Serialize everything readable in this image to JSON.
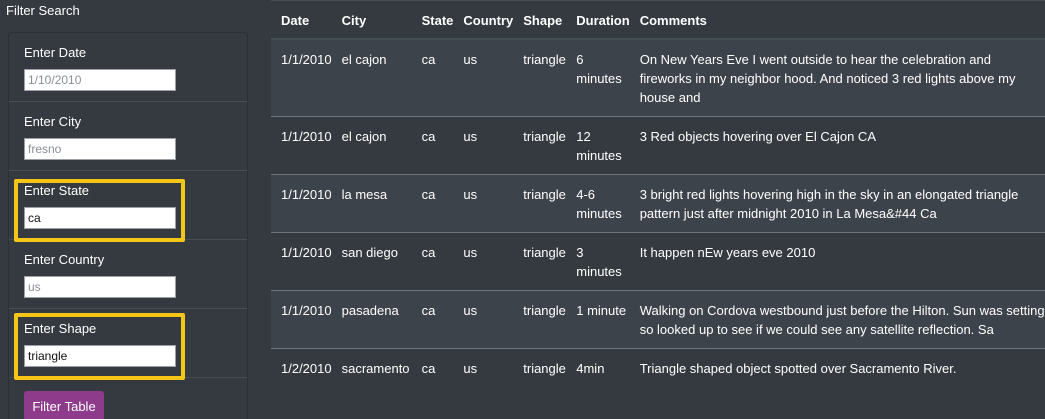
{
  "filter": {
    "title": "Filter Search",
    "fields": [
      {
        "label": "Enter Date",
        "value": "",
        "placeholder": "1/10/2010"
      },
      {
        "label": "Enter City",
        "value": "",
        "placeholder": "fresno"
      },
      {
        "label": "Enter State",
        "value": "ca",
        "placeholder": ""
      },
      {
        "label": "Enter Country",
        "value": "",
        "placeholder": "us"
      },
      {
        "label": "Enter Shape",
        "value": "triangle",
        "placeholder": ""
      }
    ],
    "button_label": "Filter Table",
    "highlight_color": "#f5c518",
    "button_color": "#8e3b8b"
  },
  "table": {
    "headers": [
      "Date",
      "City",
      "State",
      "Country",
      "Shape",
      "Duration",
      "Comments"
    ],
    "rows": [
      [
        "1/1/2010",
        "el cajon",
        "ca",
        "us",
        "triangle",
        "6 minutes",
        "On New Years Eve I went outside to hear the celebration and fireworks in my neighbor hood. And noticed 3 red lights above my house and"
      ],
      [
        "1/1/2010",
        "el cajon",
        "ca",
        "us",
        "triangle",
        "12 minutes",
        "3 Red objects hovering over El Cajon CA"
      ],
      [
        "1/1/2010",
        "la mesa",
        "ca",
        "us",
        "triangle",
        "4-6 minutes",
        "3 bright red lights hovering high in the sky in an elongated triangle pattern just after midnight 2010 in La Mesa&#44 Ca"
      ],
      [
        "1/1/2010",
        "san diego",
        "ca",
        "us",
        "triangle",
        "3 minutes",
        "It happen nEw years eve 2010"
      ],
      [
        "1/1/2010",
        "pasadena",
        "ca",
        "us",
        "triangle",
        "1 minute",
        "Walking on Cordova westbound just before the Hilton. Sun was setting so looked up to see if we could see any satellite reflection. Sa"
      ],
      [
        "1/2/2010",
        "sacramento",
        "ca",
        "us",
        "triangle",
        "4min",
        "Triangle shaped object spotted over Sacramento River."
      ]
    ]
  }
}
